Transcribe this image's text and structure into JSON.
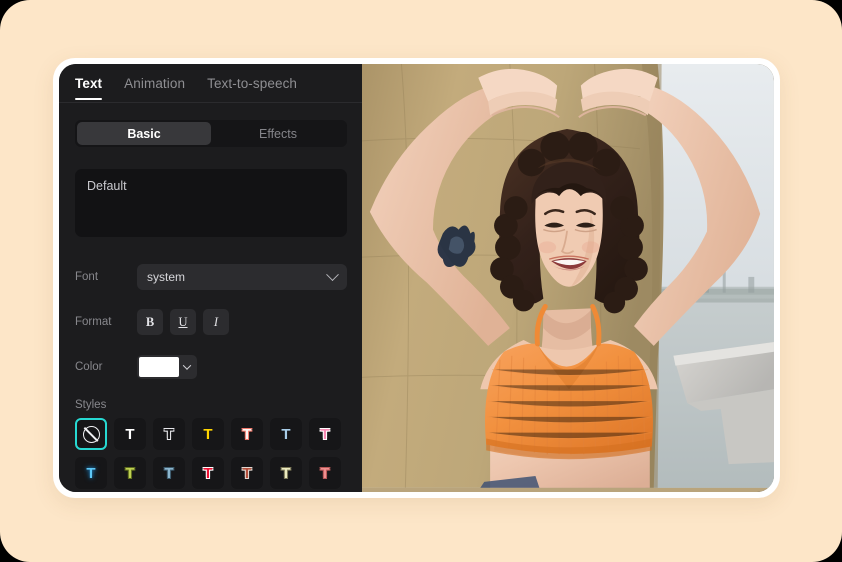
{
  "canvas": {
    "background": "#FDE6C8"
  },
  "window": {
    "frame_color": "#ffffff",
    "panel_background": "#1c1c1e"
  },
  "tabs": [
    {
      "label": "Text",
      "active": true
    },
    {
      "label": "Animation",
      "active": false
    },
    {
      "label": "Text-to-speech",
      "active": false
    }
  ],
  "segmented": [
    {
      "label": "Basic",
      "active": true
    },
    {
      "label": "Effects",
      "active": false
    }
  ],
  "text_area": {
    "value": "Default",
    "placeholder": "Default"
  },
  "font_row": {
    "label": "Font",
    "value": "system",
    "icon": "chevron-down-icon"
  },
  "format_row": {
    "label": "Format",
    "buttons": [
      {
        "name": "bold-button",
        "glyph": "B"
      },
      {
        "name": "underline-button",
        "glyph": "U"
      },
      {
        "name": "italic-button",
        "glyph": "I"
      }
    ]
  },
  "color_row": {
    "label": "Color",
    "value": "#ffffff",
    "icon": "chevron-down-icon"
  },
  "styles": {
    "label": "Styles",
    "selected_index": 0,
    "selection_color": "#27d9d2",
    "tiles": [
      {
        "name": "style-none",
        "glyph": "none",
        "fill": "",
        "stroke": "",
        "shadow": ""
      },
      {
        "name": "style-white-solid",
        "glyph": "T",
        "fill": "#ffffff",
        "stroke": "",
        "shadow": ""
      },
      {
        "name": "style-white-outline",
        "glyph": "T",
        "fill": "#161618",
        "stroke": "#e8e8ec",
        "shadow": ""
      },
      {
        "name": "style-yellow",
        "glyph": "T",
        "fill": "#ffd400",
        "stroke": "",
        "shadow": ""
      },
      {
        "name": "style-white-red",
        "glyph": "T",
        "fill": "#fdf5f2",
        "stroke": "#f0776a",
        "shadow": ""
      },
      {
        "name": "style-lightblue",
        "glyph": "T",
        "fill": "#a9cde8",
        "stroke": "",
        "shadow": ""
      },
      {
        "name": "style-pink",
        "glyph": "T",
        "fill": "#f98ab4",
        "stroke": "#ffffff",
        "shadow": ""
      },
      {
        "name": "style-cyan-glow",
        "glyph": "T",
        "fill": "#5ec7f5",
        "stroke": "",
        "shadow": "#1a6fa8"
      },
      {
        "name": "style-olive",
        "glyph": "T",
        "fill": "#bfd152",
        "stroke": "#5d6b1e",
        "shadow": ""
      },
      {
        "name": "style-steelblue",
        "glyph": "T",
        "fill": "#8cb6cf",
        "stroke": "#3d5a6b",
        "shadow": ""
      },
      {
        "name": "style-red-white",
        "glyph": "T",
        "fill": "#ee1133",
        "stroke": "#ffffff",
        "shadow": ""
      },
      {
        "name": "style-brick",
        "glyph": "T",
        "fill": "#b4503c",
        "stroke": "#e3d9d2",
        "shadow": ""
      },
      {
        "name": "style-cream",
        "glyph": "T",
        "fill": "#ecebc0",
        "stroke": "#7a7656",
        "shadow": ""
      },
      {
        "name": "style-salmon",
        "glyph": "T",
        "fill": "#ef8f8f",
        "stroke": "#b85858",
        "shadow": ""
      }
    ]
  },
  "preview": {
    "name": "video-preview",
    "description": "Young woman with curly brown hair in an orange knit crop top, arms raised overhead, standing in front of a tan tarp wall by the waterfront"
  }
}
